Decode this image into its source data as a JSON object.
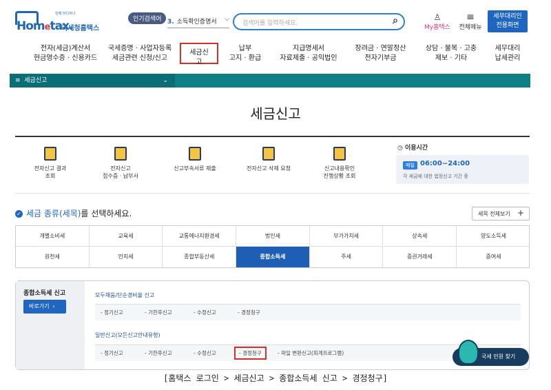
{
  "header": {
    "logo_tagline": "언제 어디서나",
    "logo_brand": "Hom",
    "logo_brand_e": "e",
    "logo_brand_tail": "tax.",
    "logo_sub": "국세청홈택스",
    "popular_badge": "인기검색어",
    "popular_rank": "3.",
    "popular_item": "소득확인증명서",
    "search_placeholder": "검색어를 입력하세요.",
    "myhome_label": "My홈택스",
    "allmenu_label": "전체메뉴",
    "agent_button": [
      "세무대리인",
      "전용화면"
    ]
  },
  "gnb": [
    [
      "전자(세금)계산서",
      "현금영수증 · 신용카드"
    ],
    [
      "국세증명 · 사업자등록",
      "세금관련 신청/신고"
    ],
    [
      "세금신고",
      ""
    ],
    [
      "납부",
      "고지 · 환급"
    ],
    [
      "지급명세서",
      "자료제출 · 공익법인"
    ],
    [
      "장려금 · 연말정산",
      "전자기부금"
    ],
    [
      "상담 · 불복 · 고충",
      "제보 · 기타"
    ],
    [
      "세무대리",
      "납세관리"
    ]
  ],
  "breadcrumb": {
    "home_icon": "menu-icon",
    "section": "세금신고"
  },
  "page_title": "세금신고",
  "services": [
    [
      "전자신고 결과",
      "조회"
    ],
    [
      "전자신고",
      "접수증 · 납부서"
    ],
    [
      "신고부속서류 제출",
      ""
    ],
    [
      "전자신고 삭제 요청",
      ""
    ],
    [
      "신고내용확인",
      "진행상황 조회"
    ]
  ],
  "hours": {
    "title": "이용시간",
    "badge": "매일",
    "time": "06:00~24:00",
    "note": "각 세금에 대한 법정신고 기간 중"
  },
  "tax_select": {
    "title_hl": "세금 종류(세목)",
    "title_rest": "를 선택하세요.",
    "view_all": "세목 전체보기",
    "cells": [
      "개별소비세",
      "교육세",
      "교통에너지환경세",
      "법인세",
      "부가가치세",
      "상속세",
      "양도소득세",
      "원천세",
      "인지세",
      "종합부동산세",
      "종합소득세",
      "주세",
      "증권거래세",
      "증여세"
    ],
    "active": "종합소득세"
  },
  "filing": {
    "title": "종합소득세 신고",
    "go_button": "바로가기",
    "group1_title": "모두채움/단순경비율 신고",
    "group1_items": [
      "- 정기신고",
      "- 기한후신고",
      "- 수정신고",
      "- 경정청구"
    ],
    "group2_title": "일반신고(모든신고안내유형)",
    "group2_items": [
      "- 정기신고",
      "- 기한후신고",
      "- 수정신고",
      "- 경정청구",
      "- 파일 변환신고(회계프로그램)"
    ]
  },
  "float_button": "국세 민원 찾기",
  "caption": "[홈택스 로그인 > 세금신고 > 종합소득세 신고 > 경정청구]"
}
